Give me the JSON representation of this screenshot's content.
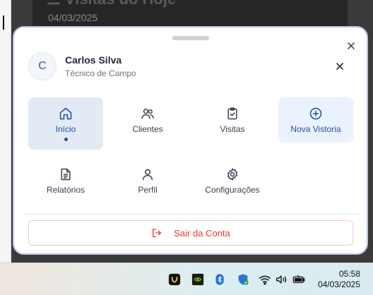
{
  "background_app": {
    "title": "Visitas do Hoje",
    "date": "04/03/2025"
  },
  "profile": {
    "avatar_initial": "C",
    "name": "Carlos Silva",
    "role": "Técnico de Campo"
  },
  "nav": {
    "items": [
      {
        "label": "Início",
        "icon": "home-icon",
        "state": "active"
      },
      {
        "label": "Clientes",
        "icon": "users-icon"
      },
      {
        "label": "Visitas",
        "icon": "clipboard-check-icon"
      },
      {
        "label": "Nova Vistoria",
        "icon": "plus-circle-icon",
        "state": "highlighted"
      },
      {
        "label": "Relatórios",
        "icon": "file-text-icon"
      },
      {
        "label": "Perfil",
        "icon": "user-icon"
      },
      {
        "label": "Configurações",
        "icon": "gear-icon"
      }
    ]
  },
  "logout": {
    "label": "Sair da Conta",
    "icon": "logout-icon"
  },
  "colors": {
    "accent": "#1d4e9e",
    "active_bg": "#e2eaf6",
    "danger": "#e53935",
    "sheet_border": "#c4bff0"
  },
  "taskbar": {
    "time": "05:58",
    "date": "04/03/2025",
    "tray_icons": [
      "app-icon",
      "nvidia-icon",
      "bluetooth-icon",
      "security-shield-icon",
      "wifi-icon",
      "volume-icon",
      "battery-icon"
    ]
  }
}
